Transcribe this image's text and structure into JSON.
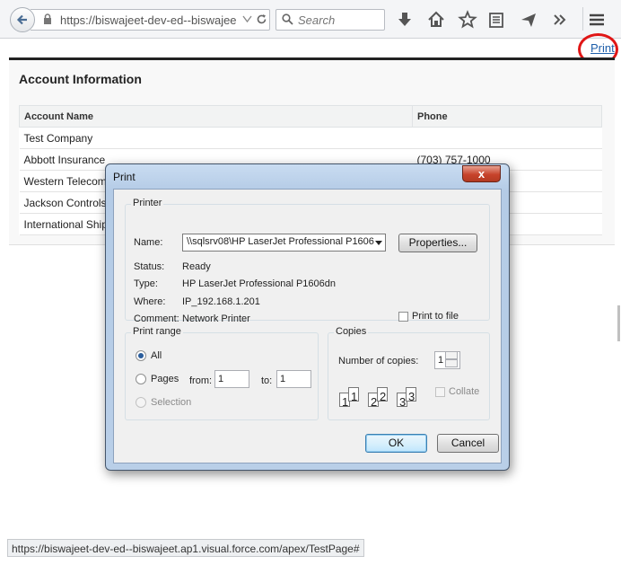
{
  "browser": {
    "url": "https://biswajeet-dev-ed--biswajeet",
    "search_placeholder": "Search",
    "status_url": "https://biswajeet-dev-ed--biswajeet.ap1.visual.force.com/apex/TestPage#"
  },
  "page": {
    "print_link": "Print",
    "section_title": "Account Information",
    "columns": [
      "Account Name",
      "Phone"
    ],
    "rows": [
      {
        "name": "Test Company",
        "phone": ""
      },
      {
        "name": "Abbott Insurance",
        "phone": "(703) 757-1000"
      },
      {
        "name": "Western Telecom",
        "phone": ""
      },
      {
        "name": "Jackson Controls",
        "phone": ""
      },
      {
        "name": "International Ship",
        "phone": ""
      }
    ]
  },
  "dialog": {
    "title": "Print",
    "close_label": "x",
    "printer_group": "Printer",
    "name_label": "Name:",
    "printer_name": "\\\\sqlsrv08\\HP LaserJet Professional P1606",
    "properties_button": "Properties...",
    "status_label": "Status:",
    "status_value": "Ready",
    "type_label": "Type:",
    "type_value": "HP LaserJet Professional P1606dn",
    "where_label": "Where:",
    "where_value": "IP_192.168.1.201",
    "comment_label": "Comment:",
    "comment_value": "Network Printer",
    "print_to_file": "Print to file",
    "print_range_group": "Print range",
    "all_label": "All",
    "pages_label": "Pages",
    "from_label": "from:",
    "from_value": "1",
    "to_label": "to:",
    "to_value": "1",
    "selection_label": "Selection",
    "copies_group": "Copies",
    "copies_label": "Number of copies:",
    "copies_value": "1",
    "collate_label": "Collate",
    "collate_icon_numbers": [
      "1",
      "1",
      "2",
      "2",
      "3",
      "3"
    ],
    "ok_button": "OK",
    "cancel_button": "Cancel"
  }
}
